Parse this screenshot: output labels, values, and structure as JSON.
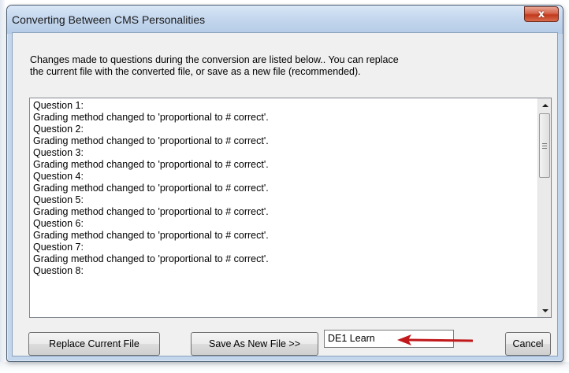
{
  "window": {
    "title": "Converting Between CMS Personalities",
    "close_glyph": "x"
  },
  "description": {
    "line1": "Changes made to questions during the conversion are listed below..  You can replace",
    "line2": "the current file with the converted file, or save as a new file (recommended)."
  },
  "changes_log": {
    "lines": [
      "Question 1:",
      "Grading method changed to 'proportional to # correct'.",
      "Question 2:",
      "Grading method changed to 'proportional to # correct'.",
      "Question 3:",
      "Grading method changed to 'proportional to # correct'.",
      "Question 4:",
      "Grading method changed to 'proportional to # correct'.",
      "Question 5:",
      "Grading method changed to 'proportional to # correct'.",
      "Question 6:",
      "Grading method changed to 'proportional to # correct'.",
      "Question 7:",
      "Grading method changed to 'proportional to # correct'.",
      "Question 8:"
    ]
  },
  "buttons": {
    "replace_label": "Replace Current File",
    "save_as_label": "Save As New File >>",
    "cancel_label": "Cancel"
  },
  "new_file_name": {
    "value": "DE1 Learn"
  },
  "annotation": {
    "arrow_color": "#c0181b"
  },
  "icons": {
    "close": "close-icon",
    "scroll_up": "scroll-up-arrow-icon",
    "scroll_down": "scroll-down-arrow-icon",
    "thumb_grip": "grip-icon",
    "annotation_arrow": "red-arrow-icon"
  }
}
